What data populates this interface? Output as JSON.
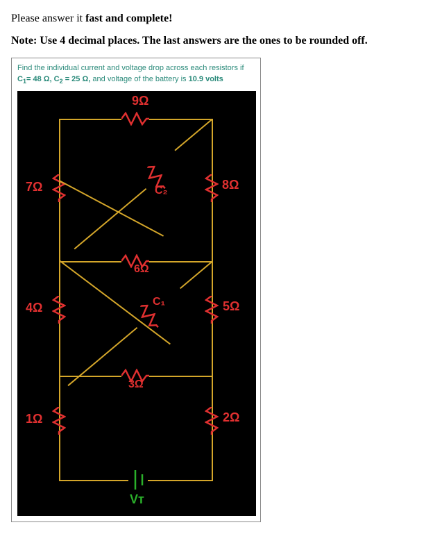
{
  "instruction1_pre": "Please answer it ",
  "instruction1_bold": "fast and complete!",
  "instruction2_pre": "Note: Use 4 decimal places. The last answers are the ones to be rounded off.",
  "problem_line1": "Find the individual current and voltage drop across each resistors if",
  "problem_c1_pre": "C",
  "problem_c1_sub": "1",
  "problem_c1_eq": "= 48 Ω, ",
  "problem_c2_pre": "C",
  "problem_c2_sub": "2",
  "problem_c2_eq": " = 25 Ω,",
  "problem_rest": " and voltage of the battery is ",
  "problem_volt": "10.9 volts",
  "r_top": "9Ω",
  "r_7": "7Ω",
  "r_8": "8Ω",
  "r_6": "6Ω",
  "r_4": "4Ω",
  "r_5": "5Ω",
  "r_3": "3Ω",
  "r_1": "1Ω",
  "r_2": "2Ω",
  "c1_label": "C₁",
  "c2_label": "C₂",
  "vt_label": "V_T",
  "vt_display": "Vᴛ"
}
